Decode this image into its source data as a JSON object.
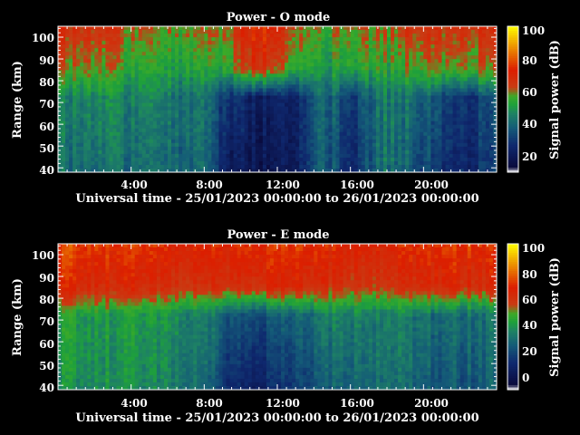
{
  "chart_data": [
    {
      "type": "heatmap",
      "title": "Power - O mode",
      "xlabel": "Universal time - 25/01/2023 00:00:00 to 26/01/2023 00:00:00",
      "ylabel": "Range (km)",
      "x_ticks": [
        "4:00",
        "8:00",
        "12:00",
        "16:00",
        "20:00"
      ],
      "x_tick_hours": [
        4,
        8,
        12,
        16,
        20
      ],
      "xlim": [
        0,
        24
      ],
      "y_ticks": [
        40,
        50,
        60,
        70,
        80,
        90,
        100
      ],
      "ylim": [
        38,
        105
      ],
      "colorbar": {
        "label": "Signal power (dB)",
        "ticks": [
          20,
          40,
          60,
          80,
          100
        ],
        "range": [
          10,
          100
        ]
      },
      "profile": [
        {
          "t": 0.0,
          "top": 60,
          "mid": 46,
          "low": 42
        },
        {
          "t": 2.0,
          "top": 58,
          "mid": 46,
          "low": 41
        },
        {
          "t": 5.0,
          "top": 52,
          "mid": 45,
          "low": 40
        },
        {
          "t": 8.0,
          "top": 50,
          "mid": 40,
          "low": 38
        },
        {
          "t": 9.5,
          "top": 55,
          "mid": 28,
          "low": 20
        },
        {
          "t": 11.0,
          "top": 68,
          "mid": 22,
          "low": 18
        },
        {
          "t": 13.0,
          "top": 55,
          "mid": 25,
          "low": 22
        },
        {
          "t": 14.5,
          "top": 50,
          "mid": 42,
          "low": 40
        },
        {
          "t": 16.0,
          "top": 52,
          "mid": 30,
          "low": 25
        },
        {
          "t": 18.0,
          "top": 52,
          "mid": 44,
          "low": 42
        },
        {
          "t": 20.0,
          "top": 60,
          "mid": 40,
          "low": 34
        },
        {
          "t": 22.0,
          "top": 58,
          "mid": 28,
          "low": 25
        },
        {
          "t": 24.0,
          "top": 60,
          "mid": 35,
          "low": 30
        }
      ]
    },
    {
      "type": "heatmap",
      "title": "Power - E mode",
      "xlabel": "Universal time - 25/01/2023 00:00:00 to 26/01/2023 00:00:00",
      "ylabel": "Range (km)",
      "x_ticks": [
        "4:00",
        "8:00",
        "12:00",
        "16:00",
        "20:00"
      ],
      "x_tick_hours": [
        4,
        8,
        12,
        16,
        20
      ],
      "xlim": [
        0,
        24
      ],
      "y_ticks": [
        40,
        50,
        60,
        70,
        80,
        90,
        100
      ],
      "ylim": [
        38,
        105
      ],
      "colorbar": {
        "label": "Signal power (dB)",
        "ticks": [
          0,
          20,
          40,
          60,
          80,
          100
        ],
        "range": [
          0,
          100
        ]
      },
      "profile": [
        {
          "t": 0.0,
          "top": 68,
          "mid": 46,
          "low": 42
        },
        {
          "t": 3.0,
          "top": 66,
          "mid": 45,
          "low": 42
        },
        {
          "t": 6.0,
          "top": 64,
          "mid": 44,
          "low": 40
        },
        {
          "t": 8.0,
          "top": 62,
          "mid": 38,
          "low": 33
        },
        {
          "t": 9.5,
          "top": 64,
          "mid": 30,
          "low": 18
        },
        {
          "t": 11.0,
          "top": 66,
          "mid": 28,
          "low": 15
        },
        {
          "t": 13.0,
          "top": 64,
          "mid": 30,
          "low": 20
        },
        {
          "t": 15.0,
          "top": 62,
          "mid": 38,
          "low": 30
        },
        {
          "t": 18.0,
          "top": 62,
          "mid": 40,
          "low": 36
        },
        {
          "t": 21.0,
          "top": 66,
          "mid": 34,
          "low": 28
        },
        {
          "t": 24.0,
          "top": 64,
          "mid": 36,
          "low": 30
        }
      ]
    }
  ]
}
